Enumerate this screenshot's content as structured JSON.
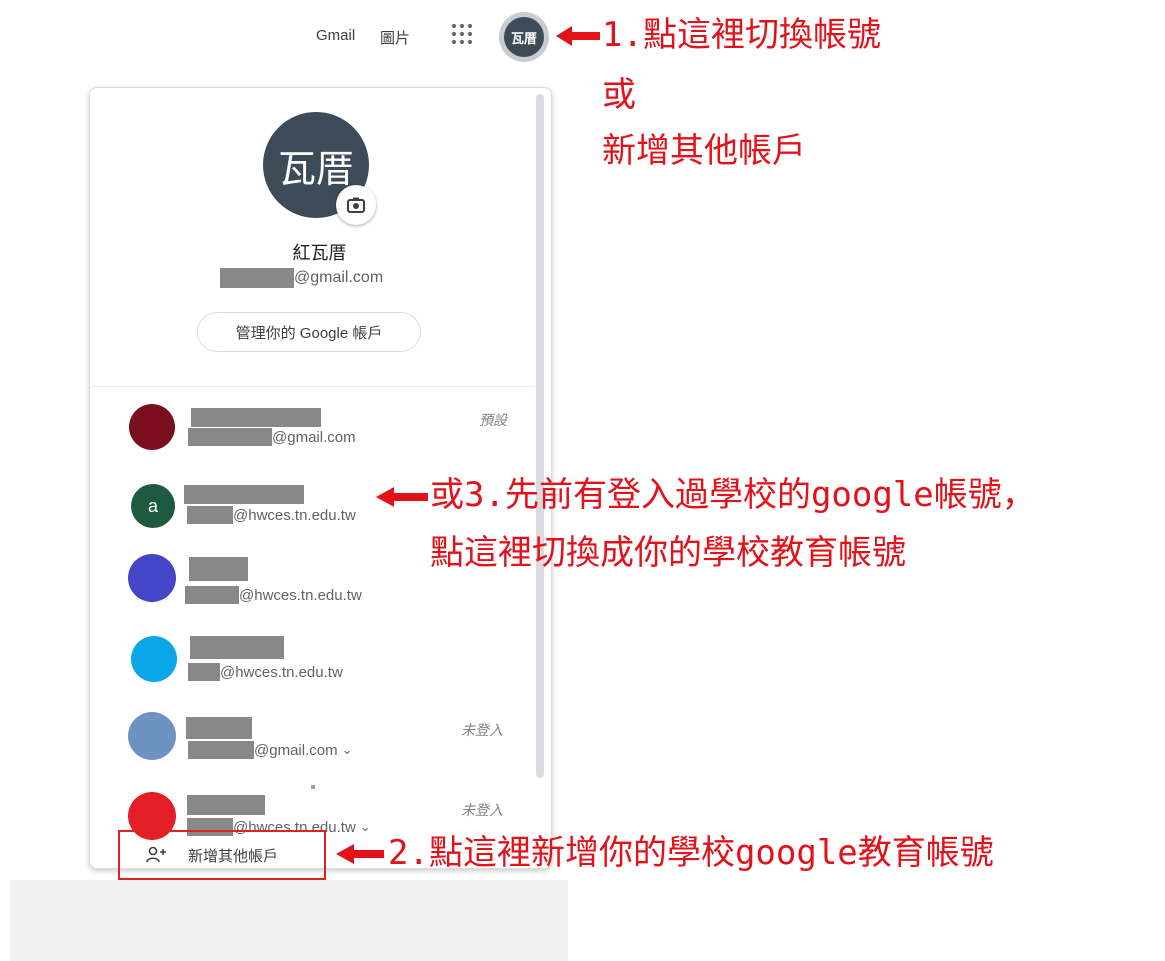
{
  "topbar": {
    "gmail": "Gmail",
    "images": "圖片",
    "avatar_initials": "瓦厝"
  },
  "profile": {
    "avatar_text": "瓦厝",
    "name": "紅瓦厝",
    "email_suffix": "@gmail.com",
    "manage_button": "管理你的 Google 帳戶"
  },
  "accounts": [
    {
      "initial": "",
      "color": "#7a0d1e",
      "email_suffix": "@gmail.com",
      "tag": "預設",
      "chevron": false
    },
    {
      "initial": "a",
      "color": "#1e5a3e",
      "email_suffix": "@hwces.tn.edu.tw",
      "tag": "",
      "chevron": false
    },
    {
      "initial": "",
      "color": "#4446c9",
      "email_suffix": "@hwces.tn.edu.tw",
      "tag": "",
      "chevron": false
    },
    {
      "initial": "",
      "color": "#0ba6e8",
      "email_suffix": "@hwces.tn.edu.tw",
      "tag": "",
      "chevron": false
    },
    {
      "initial": "",
      "color": "#6d92c2",
      "email_suffix": "@gmail.com",
      "tag": "未登入",
      "chevron": true
    },
    {
      "initial": "",
      "color": "#e41e26",
      "email_suffix": "@hwces.tn.edu.tw",
      "tag": "未登入",
      "chevron": true
    }
  ],
  "add_account": {
    "label": "新增其他帳戶"
  },
  "annotations": {
    "step1_line1": "1.點這裡切換帳號",
    "step1_line2": "或",
    "step1_line3": "新增其他帳戶",
    "step3_line1": "或3.先前有登入過學校的google帳號，",
    "step3_line2": "點這裡切換成你的學校教育帳號",
    "step2": "2.點這裡新增你的學校google教育帳號"
  },
  "colors": {
    "annotation_red": "#e3121a",
    "avatar_slate": "#3d4b58"
  },
  "icons": [
    "apps-grid-icon",
    "camera-icon",
    "add-person-icon",
    "chevron-down-icon",
    "red-arrow-icon"
  ]
}
